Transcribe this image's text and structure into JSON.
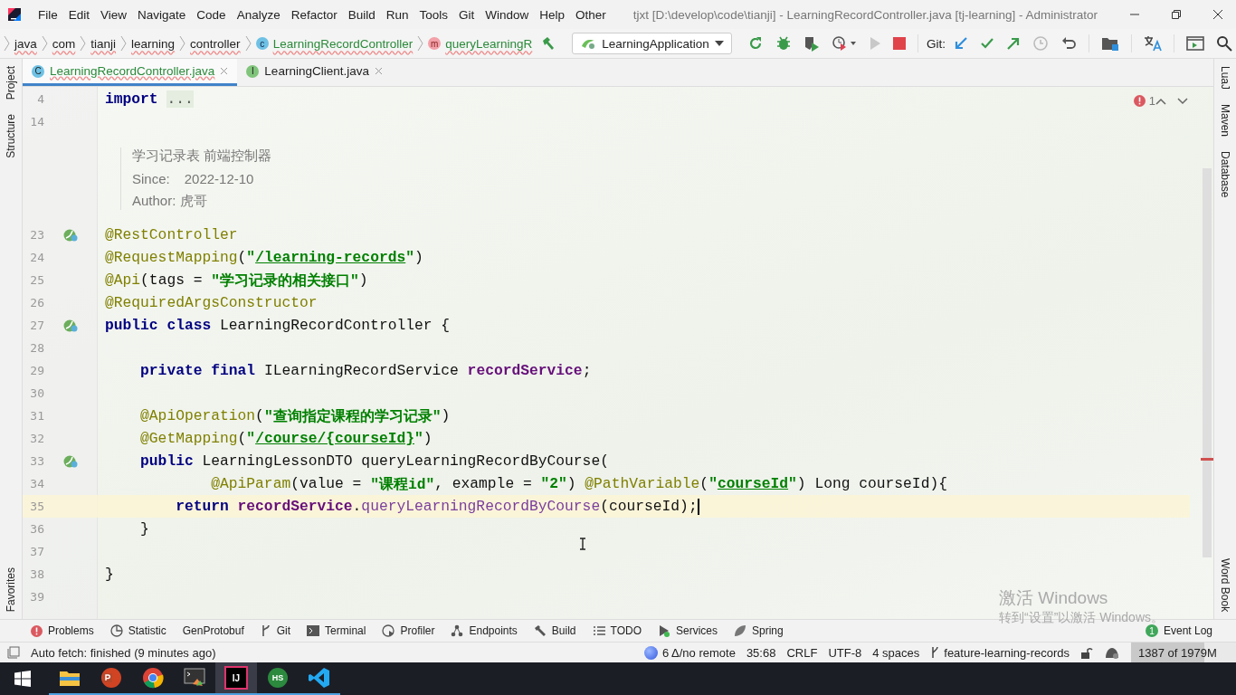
{
  "title_bar": {
    "menu": [
      "File",
      "Edit",
      "View",
      "Navigate",
      "Code",
      "Analyze",
      "Refactor",
      "Build",
      "Run",
      "Tools",
      "Git",
      "Window",
      "Help",
      "Other"
    ],
    "title": "tjxt [D:\\develop\\code\\tianji] - LearningRecordController.java [tj-learning] - Administrator"
  },
  "nav_bar": {
    "breadcrumbs": [
      {
        "kind": "package",
        "text": "java"
      },
      {
        "kind": "package",
        "text": "com"
      },
      {
        "kind": "package",
        "text": "tianji"
      },
      {
        "kind": "package",
        "text": "learning"
      },
      {
        "kind": "package",
        "text": "controller"
      },
      {
        "kind": "class",
        "badge": "c",
        "text": "LearningRecordController"
      },
      {
        "kind": "method",
        "badge": "m",
        "text": "queryLearningR"
      }
    ],
    "run_config": "LearningApplication",
    "git_label": "Git:"
  },
  "left_strip": {
    "top": [
      "Project",
      "Structure"
    ],
    "bottom": [
      "Favorites"
    ]
  },
  "right_strip": {
    "top": [
      "LuaJ",
      "Maven",
      "Database"
    ],
    "bottom": [
      "Word Book"
    ]
  },
  "tabs": [
    {
      "badge": "C",
      "kind": "class",
      "label": "LearningRecordController.java",
      "selected": true
    },
    {
      "badge": "I",
      "kind": "interface",
      "label": "LearningClient.java",
      "selected": false
    }
  ],
  "editor": {
    "problems": "1",
    "lines": [
      {
        "kind": "code",
        "number": "4",
        "marked": false,
        "current": false,
        "tokens": [
          {
            "kind": "kw",
            "text": "import "
          },
          {
            "kind": "fold",
            "text": "..."
          }
        ]
      },
      {
        "kind": "code",
        "number": "14",
        "marked": false,
        "current": false
      },
      {
        "kind": "doc",
        "summary": "学习记录表 前端控制器",
        "since_label": "Since:",
        "since": "2022-12-10",
        "author": "Author: 虎哥"
      },
      {
        "kind": "code",
        "number": "23",
        "marked": true,
        "current": false,
        "tokens": [
          {
            "kind": "ann",
            "text": "@RestController"
          }
        ]
      },
      {
        "kind": "code",
        "number": "24",
        "marked": false,
        "current": false,
        "tokens": [
          {
            "kind": "ann",
            "text": "@RequestMapping"
          },
          {
            "kind": "plain",
            "text": "("
          },
          {
            "kind": "str",
            "text": "\""
          },
          {
            "kind": "link",
            "text": "/learning-records"
          },
          {
            "kind": "str",
            "text": "\""
          },
          {
            "kind": "plain",
            "text": ")"
          }
        ]
      },
      {
        "kind": "code",
        "number": "25",
        "marked": false,
        "current": false,
        "tokens": [
          {
            "kind": "ann",
            "text": "@Api"
          },
          {
            "kind": "plain",
            "text": "(tags = "
          },
          {
            "kind": "str",
            "text": "\"学习记录的相关接口\""
          },
          {
            "kind": "plain",
            "text": ")"
          }
        ]
      },
      {
        "kind": "code",
        "number": "26",
        "marked": false,
        "current": false,
        "tokens": [
          {
            "kind": "ann",
            "text": "@RequiredArgsConstructor"
          }
        ]
      },
      {
        "kind": "code",
        "number": "27",
        "marked": true,
        "current": false,
        "tokens": [
          {
            "kind": "kw",
            "text": "public class"
          },
          {
            "kind": "plain",
            "text": " LearningRecordController {"
          }
        ]
      },
      {
        "kind": "code",
        "number": "28",
        "marked": false,
        "current": false
      },
      {
        "kind": "code",
        "number": "29",
        "marked": false,
        "current": false,
        "tokens": [
          {
            "kind": "kw",
            "text": "    private final"
          },
          {
            "kind": "plain",
            "text": " ILearningRecordService "
          },
          {
            "kind": "field",
            "text": "recordService"
          },
          {
            "kind": "plain",
            "text": ";"
          }
        ]
      },
      {
        "kind": "code",
        "number": "30",
        "marked": false,
        "current": false
      },
      {
        "kind": "code",
        "number": "31",
        "marked": false,
        "current": false,
        "tokens": [
          {
            "kind": "ann",
            "text": "    @ApiOperation"
          },
          {
            "kind": "plain",
            "text": "("
          },
          {
            "kind": "str",
            "text": "\"查询指定课程的学习记录\""
          },
          {
            "kind": "plain",
            "text": ")"
          }
        ]
      },
      {
        "kind": "code",
        "number": "32",
        "marked": false,
        "current": false,
        "tokens": [
          {
            "kind": "ann",
            "text": "    @GetMapping"
          },
          {
            "kind": "plain",
            "text": "("
          },
          {
            "kind": "str",
            "text": "\""
          },
          {
            "kind": "link",
            "text": "/course/{courseId}"
          },
          {
            "kind": "str",
            "text": "\""
          },
          {
            "kind": "plain",
            "text": ")"
          }
        ]
      },
      {
        "kind": "code",
        "number": "33",
        "marked": true,
        "current": false,
        "tokens": [
          {
            "kind": "kw",
            "text": "    public"
          },
          {
            "kind": "plain",
            "text": " LearningLessonDTO queryLearningRecordByCourse("
          }
        ]
      },
      {
        "kind": "code",
        "number": "34",
        "marked": false,
        "current": false,
        "tokens": [
          {
            "kind": "ann",
            "text": "            @ApiParam"
          },
          {
            "kind": "plain",
            "text": "(value = "
          },
          {
            "kind": "str",
            "text": "\"课程id\""
          },
          {
            "kind": "plain",
            "text": ", example = "
          },
          {
            "kind": "str",
            "text": "\"2\""
          },
          {
            "kind": "plain",
            "text": ") "
          },
          {
            "kind": "ann",
            "text": "@PathVariable"
          },
          {
            "kind": "plain",
            "text": "("
          },
          {
            "kind": "str",
            "text": "\""
          },
          {
            "kind": "link",
            "text": "courseId"
          },
          {
            "kind": "str",
            "text": "\""
          },
          {
            "kind": "plain",
            "text": ") Long courseId){"
          }
        ]
      },
      {
        "kind": "code",
        "number": "35",
        "marked": false,
        "current": true,
        "tokens": [
          {
            "kind": "kw",
            "text": "        return "
          },
          {
            "kind": "field",
            "text": "recordService"
          },
          {
            "kind": "plain",
            "text": "."
          },
          {
            "kind": "call",
            "text": "queryLearningRecordByCourse"
          },
          {
            "kind": "plain",
            "text": "(courseId);"
          }
        ]
      },
      {
        "kind": "code",
        "number": "36",
        "marked": false,
        "current": false,
        "tokens": [
          {
            "kind": "plain",
            "text": "    }"
          }
        ]
      },
      {
        "kind": "code",
        "number": "37",
        "marked": false,
        "current": false
      },
      {
        "kind": "code",
        "number": "38",
        "marked": false,
        "current": false,
        "tokens": [
          {
            "kind": "plain",
            "text": "}"
          }
        ]
      },
      {
        "kind": "code",
        "number": "39",
        "marked": false,
        "current": false
      }
    ]
  },
  "activation": {
    "title": "激活 Windows",
    "hint": "转到“设置”以激活 Windows。"
  },
  "tool_bar": {
    "items": [
      {
        "kind": "problems",
        "label": "Problems"
      },
      {
        "kind": "statistic",
        "label": "Statistic"
      },
      {
        "kind": "plain",
        "label": "GenProtobuf"
      },
      {
        "kind": "git",
        "label": "Git"
      },
      {
        "kind": "terminal",
        "label": "Terminal"
      },
      {
        "kind": "profiler",
        "label": "Profiler"
      },
      {
        "kind": "endpoints",
        "label": "Endpoints"
      },
      {
        "kind": "build",
        "label": "Build"
      },
      {
        "kind": "todo",
        "label": "TODO"
      },
      {
        "kind": "services",
        "label": "Services"
      },
      {
        "kind": "spring",
        "label": "Spring"
      }
    ],
    "event_log": {
      "badge": "1",
      "label": "Event Log"
    }
  },
  "status_bar": {
    "message": "Auto fetch: finished (9 minutes ago)",
    "vcs": "6 Δ/no remote",
    "position": "35:68",
    "line_sep": "CRLF",
    "encoding": "UTF-8",
    "indent": "4 spaces",
    "branch": "feature-learning-records",
    "memory": {
      "text": "1387 of 1979M",
      "level": 0.7
    }
  },
  "taskbar": {
    "apps": [
      {
        "kind": "folder",
        "selected": false
      },
      {
        "kind": "slides",
        "selected": false
      },
      {
        "kind": "browser",
        "selected": false
      },
      {
        "kind": "console",
        "selected": false
      },
      {
        "kind": "ide",
        "label": "IJ",
        "selected": true
      },
      {
        "kind": "hs",
        "label": "HS",
        "selected": false
      },
      {
        "kind": "editor",
        "selected": false
      }
    ]
  }
}
